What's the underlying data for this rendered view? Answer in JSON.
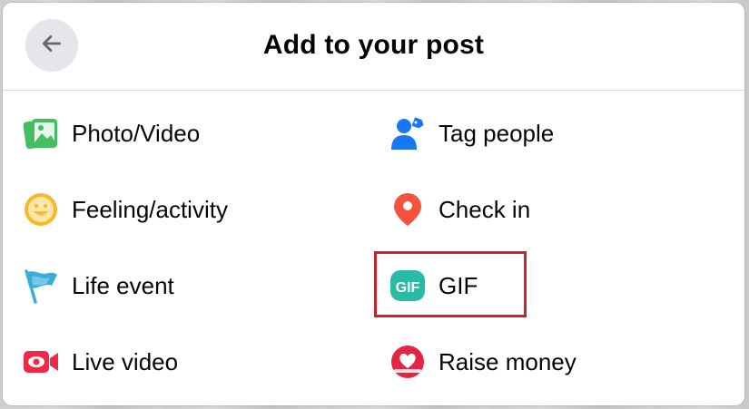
{
  "dialog": {
    "title": "Add to your post",
    "back_icon": "arrow-left-icon"
  },
  "options": {
    "photo_video": {
      "label": "Photo/Video",
      "icon": "photo-icon",
      "color": "#45bd62"
    },
    "tag_people": {
      "label": "Tag people",
      "icon": "tag-people-icon",
      "color": "#1877f2"
    },
    "feeling": {
      "label": "Feeling/activity",
      "icon": "smiley-icon",
      "color": "#f7b928"
    },
    "check_in": {
      "label": "Check in",
      "icon": "location-pin-icon",
      "color": "#f5533d"
    },
    "life_event": {
      "label": "Life event",
      "icon": "flag-icon",
      "color": "#39afd5"
    },
    "gif": {
      "label": "GIF",
      "icon": "gif-icon",
      "color": "#2abba7",
      "icon_text": "GIF"
    },
    "live_video": {
      "label": "Live video",
      "icon": "live-video-icon",
      "color": "#f02849"
    },
    "raise_money": {
      "label": "Raise money",
      "icon": "heart-donation-icon",
      "color": "#e42645"
    }
  },
  "highlight_color": "#c8242c"
}
